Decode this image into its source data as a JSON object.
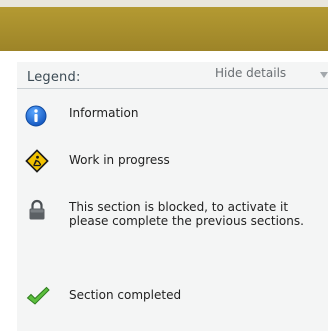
{
  "legend": {
    "title": "Legend:",
    "toggle_label": "Hide details",
    "items": [
      {
        "icon": "info-icon",
        "label": "Information"
      },
      {
        "icon": "work-in-progress-icon",
        "label": "Work in progress"
      },
      {
        "icon": "lock-icon",
        "label": "This section is blocked, to activate it please complete the previous sections."
      },
      {
        "icon": "checkmark-icon",
        "label": "Section completed"
      }
    ]
  },
  "colors": {
    "header_bar": "#a88e2c",
    "panel_bg": "#f4f5f5",
    "info_blue": "#1e6fd6",
    "wip_yellow": "#f2c200",
    "lock_gray": "#555a5e",
    "check_green": "#56b23a"
  }
}
